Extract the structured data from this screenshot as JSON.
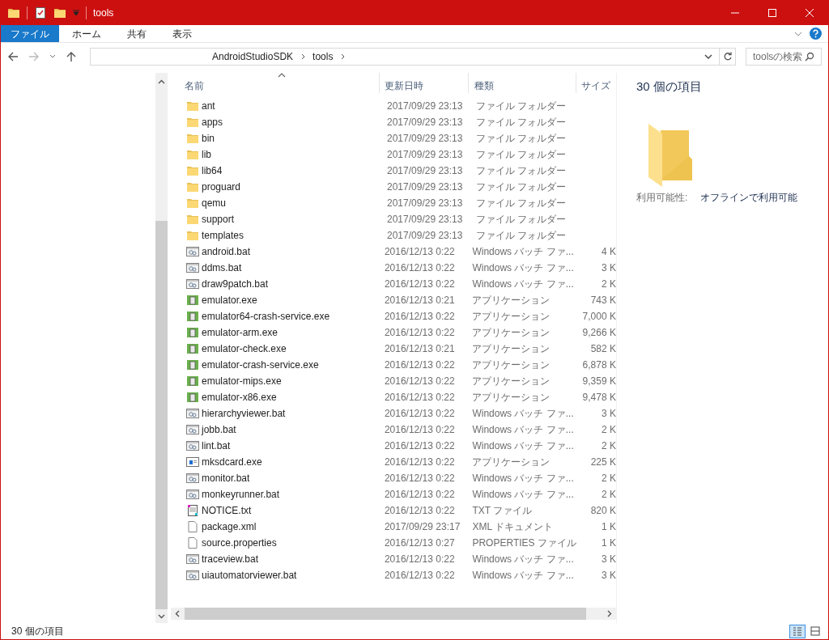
{
  "title_bar": {
    "title": "tools"
  },
  "ribbon_tabs": [
    {
      "label": "ファイル",
      "selected": true
    },
    {
      "label": "ホーム",
      "selected": false
    },
    {
      "label": "共有",
      "selected": false
    },
    {
      "label": "表示",
      "selected": false
    }
  ],
  "address": {
    "path": [
      "AndroidStudioSDK",
      "tools"
    ],
    "search_placeholder": "toolsの検索"
  },
  "columns": [
    {
      "label": "名前",
      "sorted": true
    },
    {
      "label": "更新日時",
      "sorted": false
    },
    {
      "label": "種類",
      "sorted": false
    },
    {
      "label": "サイズ",
      "sorted": false
    }
  ],
  "rows": [
    {
      "kind": "folder",
      "name": "ant",
      "date": "2017/09/29 23:13",
      "type": "ファイル フォルダー"
    },
    {
      "kind": "folder",
      "name": "apps",
      "date": "2017/09/29 23:13",
      "type": "ファイル フォルダー"
    },
    {
      "kind": "folder",
      "name": "bin",
      "date": "2017/09/29 23:13",
      "type": "ファイル フォルダー"
    },
    {
      "kind": "folder",
      "name": "lib",
      "date": "2017/09/29 23:13",
      "type": "ファイル フォルダー"
    },
    {
      "kind": "folder",
      "name": "lib64",
      "date": "2017/09/29 23:13",
      "type": "ファイル フォルダー"
    },
    {
      "kind": "folder",
      "name": "proguard",
      "date": "2017/09/29 23:13",
      "type": "ファイル フォルダー"
    },
    {
      "kind": "folder",
      "name": "qemu",
      "date": "2017/09/29 23:13",
      "type": "ファイル フォルダー"
    },
    {
      "kind": "folder",
      "name": "support",
      "date": "2017/09/29 23:13",
      "type": "ファイル フォルダー"
    },
    {
      "kind": "folder",
      "name": "templates",
      "date": "2017/09/29 23:13",
      "type": "ファイル フォルダー"
    },
    {
      "kind": "batch",
      "name": "android.bat",
      "date": "2016/12/13 0:22",
      "type": "Windows バッチ ファ...",
      "size": "4 K"
    },
    {
      "kind": "batch",
      "name": "ddms.bat",
      "date": "2016/12/13 0:22",
      "type": "Windows バッチ ファ...",
      "size": "3 K"
    },
    {
      "kind": "batch",
      "name": "draw9patch.bat",
      "date": "2016/12/13 0:22",
      "type": "Windows バッチ ファ...",
      "size": "2 K"
    },
    {
      "kind": "app",
      "name": "emulator.exe",
      "date": "2016/12/13 0:21",
      "type": "アプリケーション",
      "size": "743 K"
    },
    {
      "kind": "app",
      "name": "emulator64-crash-service.exe",
      "date": "2016/12/13 0:22",
      "type": "アプリケーション",
      "size": "7,000 K"
    },
    {
      "kind": "app",
      "name": "emulator-arm.exe",
      "date": "2016/12/13 0:22",
      "type": "アプリケーション",
      "size": "9,266 K"
    },
    {
      "kind": "app",
      "name": "emulator-check.exe",
      "date": "2016/12/13 0:21",
      "type": "アプリケーション",
      "size": "582 K"
    },
    {
      "kind": "app",
      "name": "emulator-crash-service.exe",
      "date": "2016/12/13 0:22",
      "type": "アプリケーション",
      "size": "6,878 K"
    },
    {
      "kind": "app",
      "name": "emulator-mips.exe",
      "date": "2016/12/13 0:22",
      "type": "アプリケーション",
      "size": "9,359 K"
    },
    {
      "kind": "app",
      "name": "emulator-x86.exe",
      "date": "2016/12/13 0:22",
      "type": "アプリケーション",
      "size": "9,478 K"
    },
    {
      "kind": "batch",
      "name": "hierarchyviewer.bat",
      "date": "2016/12/13 0:22",
      "type": "Windows バッチ ファ...",
      "size": "3 K"
    },
    {
      "kind": "batch",
      "name": "jobb.bat",
      "date": "2016/12/13 0:22",
      "type": "Windows バッチ ファ...",
      "size": "2 K"
    },
    {
      "kind": "batch",
      "name": "lint.bat",
      "date": "2016/12/13 0:22",
      "type": "Windows バッチ ファ...",
      "size": "2 K"
    },
    {
      "kind": "window_app",
      "name": "mksdcard.exe",
      "date": "2016/12/13 0:22",
      "type": "アプリケーション",
      "size": "225 K"
    },
    {
      "kind": "batch",
      "name": "monitor.bat",
      "date": "2016/12/13 0:22",
      "type": "Windows バッチ ファ...",
      "size": "2 K"
    },
    {
      "kind": "batch",
      "name": "monkeyrunner.bat",
      "date": "2016/12/13 0:22",
      "type": "Windows バッチ ファ...",
      "size": "2 K"
    },
    {
      "kind": "text",
      "name": "NOTICE.txt",
      "date": "2016/12/13 0:22",
      "type": "TXT ファイル",
      "size": "820 K"
    },
    {
      "kind": "file",
      "name": "package.xml",
      "date": "2017/09/29 23:17",
      "type": "XML ドキュメント",
      "size": "1 K"
    },
    {
      "kind": "file",
      "name": "source.properties",
      "date": "2016/12/13 0:27",
      "type": "PROPERTIES ファイル",
      "size": "1 K"
    },
    {
      "kind": "batch",
      "name": "traceview.bat",
      "date": "2016/12/13 0:22",
      "type": "Windows バッチ ファ...",
      "size": "3 K"
    },
    {
      "kind": "batch",
      "name": "uiautomatorviewer.bat",
      "date": "2016/12/13 0:22",
      "type": "Windows バッチ ファ...",
      "size": "3 K"
    }
  ],
  "details": {
    "count": "30 個の項目",
    "availability_label": "利用可能性:",
    "availability_value": "オフラインで利用可能"
  },
  "status_bar": {
    "text": "30 個の項目"
  },
  "views": [
    {
      "kind": "details",
      "selected": true
    },
    {
      "kind": "large_icons",
      "selected": false
    }
  ]
}
